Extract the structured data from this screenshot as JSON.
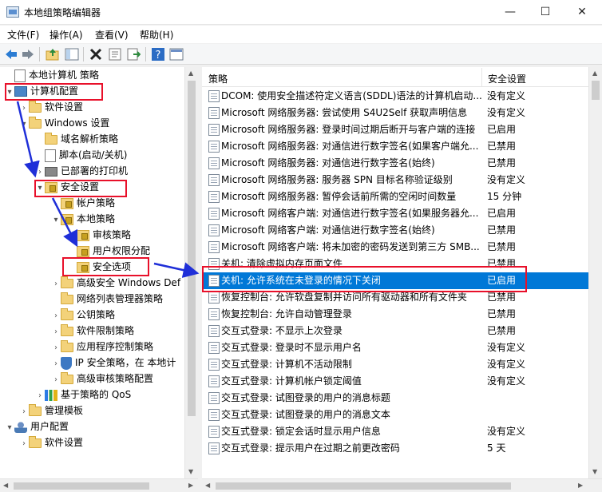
{
  "window": {
    "title": "本地组策略编辑器",
    "min": "—",
    "max": "☐",
    "close": "✕"
  },
  "menu": [
    "文件(F)",
    "操作(A)",
    "查看(V)",
    "帮助(H)"
  ],
  "toolbar_icons": [
    "back-icon",
    "forward-icon",
    "up-folder-icon",
    "show-tree-icon",
    "delete-icon",
    "properties-icon",
    "export-icon",
    "help-icon",
    "view-icon"
  ],
  "tree": [
    {
      "label": "本地计算机 策略",
      "exp": "",
      "icon": "doc",
      "indent": 0
    },
    {
      "label": "计算机配置",
      "exp": "▾",
      "icon": "computer",
      "indent": 0
    },
    {
      "label": "软件设置",
      "exp": "›",
      "icon": "folder",
      "indent": 1
    },
    {
      "label": "Windows 设置",
      "exp": "▾",
      "icon": "folder",
      "indent": 1
    },
    {
      "label": "域名解析策略",
      "exp": "",
      "icon": "folder",
      "indent": 2
    },
    {
      "label": "脚本(启动/关机)",
      "exp": "",
      "icon": "doc",
      "indent": 2
    },
    {
      "label": "已部署的打印机",
      "exp": "›",
      "icon": "printer",
      "indent": 2
    },
    {
      "label": "安全设置",
      "exp": "▾",
      "icon": "lockfolder",
      "indent": 2
    },
    {
      "label": "帐户策略",
      "exp": "›",
      "icon": "lockfolder",
      "indent": 3
    },
    {
      "label": "本地策略",
      "exp": "▾",
      "icon": "lockfolder",
      "indent": 3
    },
    {
      "label": "审核策略",
      "exp": "",
      "icon": "lockfolder",
      "indent": 4
    },
    {
      "label": "用户权限分配",
      "exp": "",
      "icon": "lockfolder",
      "indent": 4
    },
    {
      "label": "安全选项",
      "exp": "",
      "icon": "lockfolder",
      "indent": 4
    },
    {
      "label": "高级安全 Windows Def",
      "exp": "›",
      "icon": "folder",
      "indent": 3
    },
    {
      "label": "网络列表管理器策略",
      "exp": "",
      "icon": "folder",
      "indent": 3
    },
    {
      "label": "公钥策略",
      "exp": "›",
      "icon": "folder",
      "indent": 3
    },
    {
      "label": "软件限制策略",
      "exp": "›",
      "icon": "folder",
      "indent": 3
    },
    {
      "label": "应用程序控制策略",
      "exp": "›",
      "icon": "folder",
      "indent": 3
    },
    {
      "label": "IP 安全策略，在 本地计",
      "exp": "›",
      "icon": "shield",
      "indent": 3
    },
    {
      "label": "高级审核策略配置",
      "exp": "›",
      "icon": "folder",
      "indent": 3
    },
    {
      "label": "基于策略的 QoS",
      "exp": "›",
      "icon": "chart",
      "indent": 2
    },
    {
      "label": "管理模板",
      "exp": "›",
      "icon": "folder",
      "indent": 1
    },
    {
      "label": "用户配置",
      "exp": "▾",
      "icon": "user",
      "indent": 0
    },
    {
      "label": "软件设置",
      "exp": "›",
      "icon": "folder",
      "indent": 1
    }
  ],
  "columns": {
    "policy": "策略",
    "setting": "安全设置"
  },
  "rows": [
    {
      "name": "DCOM: 使用安全描述符定义语言(SDDL)语法的计算机启动...",
      "value": "没有定义"
    },
    {
      "name": "Microsoft 网络服务器: 尝试使用 S4U2Self 获取声明信息",
      "value": "没有定义"
    },
    {
      "name": "Microsoft 网络服务器: 登录时间过期后断开与客户端的连接",
      "value": "已启用"
    },
    {
      "name": "Microsoft 网络服务器: 对通信进行数字签名(如果客户端允...",
      "value": "已禁用"
    },
    {
      "name": "Microsoft 网络服务器: 对通信进行数字签名(始终)",
      "value": "已禁用"
    },
    {
      "name": "Microsoft 网络服务器: 服务器 SPN 目标名称验证级别",
      "value": "没有定义"
    },
    {
      "name": "Microsoft 网络服务器: 暂停会话前所需的空闲时间数量",
      "value": "15 分钟"
    },
    {
      "name": "Microsoft 网络客户端: 对通信进行数字签名(如果服务器允...",
      "value": "已启用"
    },
    {
      "name": "Microsoft 网络客户端: 对通信进行数字签名(始终)",
      "value": "已禁用"
    },
    {
      "name": "Microsoft 网络客户端: 将未加密的密码发送到第三方 SMB...",
      "value": "已禁用"
    },
    {
      "name": "关机: 清除虚拟内存页面文件",
      "value": "已禁用"
    },
    {
      "name": "关机: 允许系统在未登录的情况下关闭",
      "value": "已启用"
    },
    {
      "name": "恢复控制台: 允许软盘复制并访问所有驱动器和所有文件夹",
      "value": "已禁用"
    },
    {
      "name": "恢复控制台: 允许自动管理登录",
      "value": "已禁用"
    },
    {
      "name": "交互式登录: 不显示上次登录",
      "value": "已禁用"
    },
    {
      "name": "交互式登录: 登录时不显示用户名",
      "value": "没有定义"
    },
    {
      "name": "交互式登录: 计算机不活动限制",
      "value": "没有定义"
    },
    {
      "name": "交互式登录: 计算机帐户锁定阈值",
      "value": "没有定义"
    },
    {
      "name": "交互式登录: 试图登录的用户的消息标题",
      "value": ""
    },
    {
      "name": "交互式登录: 试图登录的用户的消息文本",
      "value": ""
    },
    {
      "name": "交互式登录: 锁定会话时显示用户信息",
      "value": "没有定义"
    },
    {
      "name": "交互式登录: 提示用户在过期之前更改密码",
      "value": "5 天"
    }
  ],
  "selected_row": 11,
  "colors": {
    "selection": "#0078d7",
    "annotation_red": "#e8102a",
    "annotation_arrow": "#1f2fd8"
  }
}
